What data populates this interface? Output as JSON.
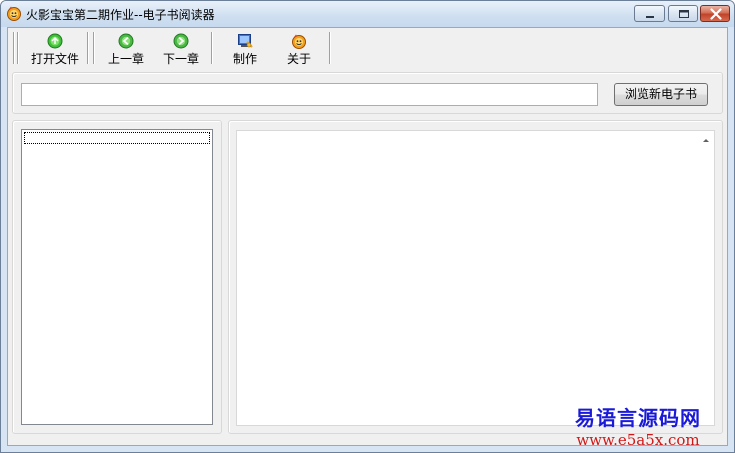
{
  "window": {
    "title": "火影宝宝第二期作业--电子书阅读器",
    "icon": "app-icon",
    "controls": [
      "minimize-icon",
      "maximize-icon",
      "close-icon"
    ]
  },
  "toolbar": {
    "items": [
      {
        "label": "打开文件",
        "icon": "open-file-icon"
      },
      {
        "label": "上一章",
        "icon": "previous-chapter-icon"
      },
      {
        "label": "下一章",
        "icon": "next-chapter-icon"
      },
      {
        "label": "制作",
        "icon": "make-icon"
      },
      {
        "label": "关于",
        "icon": "about-icon"
      }
    ]
  },
  "path_bar": {
    "value": "",
    "browse_label": "浏览新电子书"
  },
  "chapter_list": {
    "items": []
  },
  "content": {
    "text": ""
  },
  "watermark": {
    "title": "易语言源码网",
    "url": "www.e5a5x.com"
  },
  "colors": {
    "title_bar": "#cfdff0",
    "client_bg": "#f0f0f0",
    "close_button": "#c0432a",
    "watermark_blue": "#1a1ad8",
    "watermark_red": "#d01818"
  }
}
